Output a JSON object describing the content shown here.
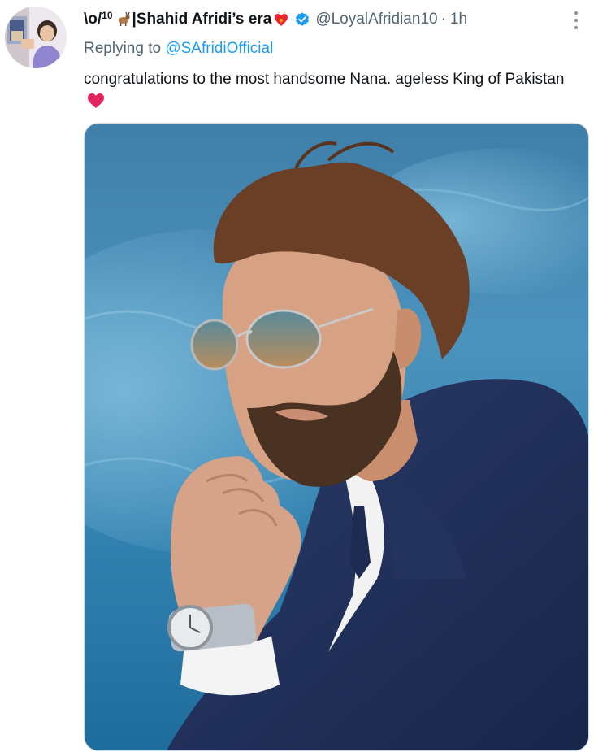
{
  "tweet": {
    "display_name": {
      "prefix": "\\o/",
      "superscript": "10",
      "goat_icon": "goat-icon",
      "name": "|Shahid Afridi’s era",
      "heart_icon": "heart-on-fire-icon"
    },
    "verified_icon": "verified-badge-icon",
    "handle": "@LoyalAfridian10",
    "separator": "·",
    "time": "1h",
    "more_icon": "more-vertical-icon",
    "reply": {
      "label": "Replying to",
      "mention": "@SAfridiOfficial"
    },
    "text": "congratulations to the most handsome Nana. ageless King of Pakistan",
    "text_emoji": "red-heart-icon",
    "media_alt": "photo"
  },
  "colors": {
    "text_primary": "#0f1419",
    "text_secondary": "#536471",
    "link": "#1d9bf0",
    "heart_red": "#e0245e",
    "verified_blue": "#1d9bf0"
  }
}
